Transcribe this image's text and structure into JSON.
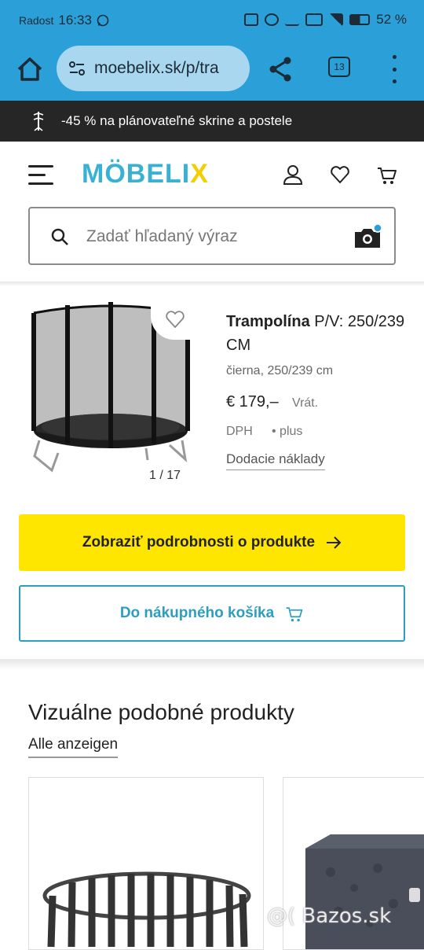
{
  "statusbar": {
    "carrier": "Radost",
    "time": "16:33",
    "battery": "52 %"
  },
  "browser": {
    "url": "moebelix.sk/p/tra",
    "tab_count": "13"
  },
  "promo": {
    "text": "-45 % na plánovateľné skrine a postele"
  },
  "header": {
    "logo_main": "MÖBELI",
    "logo_x": "X",
    "search_placeholder": "Zadať hľadaný výraz"
  },
  "product": {
    "name_bold": "Trampolína",
    "name_rest": " P/V: 250/239 CM",
    "description": "čierna, 250/239 cm",
    "price": "€ 179,–",
    "vat_note": "Vrát.",
    "vat_note2": "DPH",
    "plus": "• plus",
    "shipping_link": "Dodacie náklady",
    "image_counter": "1 / 17"
  },
  "buttons": {
    "details": "Zobraziť podrobnosti o produkte",
    "cart": "Do nákupného košíka"
  },
  "similar": {
    "title": "Vizuálne podobné produkty",
    "link": "Alle anzeigen"
  },
  "watermark": "@( Bazos.sk",
  "colors": {
    "browser_bar": "#2a9fd8",
    "promo_bg": "#262626",
    "accent": "#2c9fc0",
    "cta_yellow": "#ffe600",
    "logo_blue": "#3bb1d1",
    "logo_yellow": "#f2cf00"
  }
}
